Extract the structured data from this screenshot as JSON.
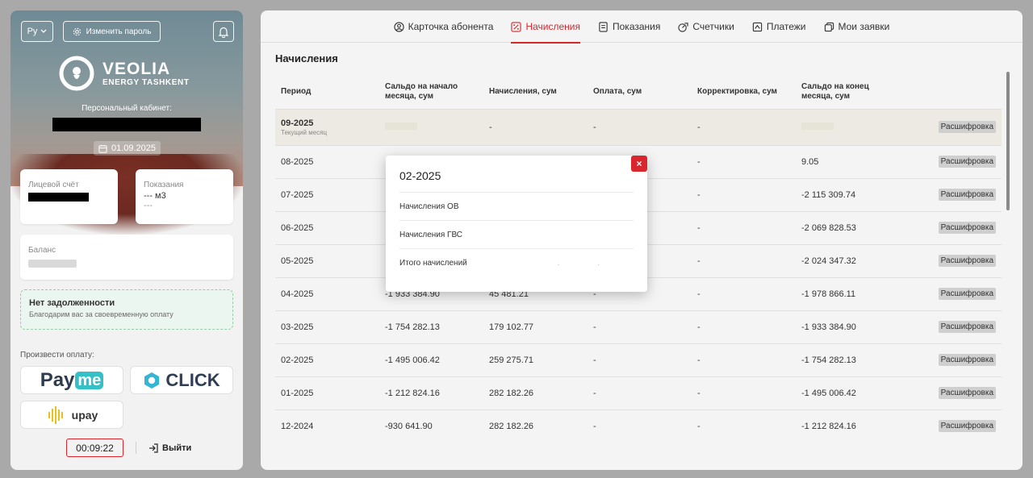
{
  "left": {
    "language": "Ру",
    "change_password": "Изменить пароль",
    "brand": {
      "line1": "VEOLIA",
      "line2": "ENERGY TASHKENT"
    },
    "personal_cabinet_label": "Персональный кабинет:",
    "date": "01.09.2025",
    "account_label": "Лицевой счёт",
    "readings_label": "Показания",
    "readings_value": "--- м3",
    "readings_sub": "---",
    "balance_label": "Баланс",
    "status_title": "Нет задолженности",
    "status_subtitle": "Благодарим вас за своевременную оплату",
    "pay_label": "Произвести оплату:",
    "payments": {
      "payme_a": "Pay",
      "payme_b": "me",
      "click": "CLICK",
      "upay": "upay"
    },
    "timer": "00:09:22",
    "logout": "Выйти"
  },
  "tabs": [
    {
      "label": "Карточка абонента",
      "icon": "user-circle-icon"
    },
    {
      "label": "Начисления",
      "icon": "percent-icon",
      "active": true
    },
    {
      "label": "Показания",
      "icon": "document-icon"
    },
    {
      "label": "Счетчики",
      "icon": "meter-icon"
    },
    {
      "label": "Платежи",
      "icon": "payment-icon"
    },
    {
      "label": "Мои заявки",
      "icon": "requests-icon"
    }
  ],
  "main": {
    "title": "Начисления",
    "columns": [
      "Период",
      "Сальдо на начало месяца, сум",
      "Начисления, сум",
      "Оплата, сум",
      "Корректировка, сум",
      "Сальдо на конец месяца, сум"
    ],
    "action_label": "Расшифровка",
    "rows": [
      {
        "period": "09-2025",
        "sub": "Текущий месяц",
        "start": "",
        "charge": "-",
        "payment": "-",
        "correction": "-",
        "end": ""
      },
      {
        "period": "08-2025",
        "start": "",
        "charge": "",
        "payment": "",
        "correction": "-",
        "end": "9.05"
      },
      {
        "period": "07-2025",
        "start": "",
        "charge": "",
        "payment": "",
        "correction": "-",
        "end": "-2 115 309.74"
      },
      {
        "period": "06-2025",
        "start": "",
        "charge": "",
        "payment": "",
        "correction": "-",
        "end": "-2 069 828.53"
      },
      {
        "period": "05-2025",
        "start": "",
        "charge": "",
        "payment": "",
        "correction": "-",
        "end": "-2 024 347.32"
      },
      {
        "period": "04-2025",
        "start": "-1 933 384.90",
        "charge": "45 481.21",
        "payment": "-",
        "correction": "-",
        "end": "-1 978 866.11"
      },
      {
        "period": "03-2025",
        "start": "-1 754 282.13",
        "charge": "179 102.77",
        "payment": "-",
        "correction": "-",
        "end": "-1 933 384.90"
      },
      {
        "period": "02-2025",
        "start": "-1 495 006.42",
        "charge": "259 275.71",
        "payment": "-",
        "correction": "-",
        "end": "-1 754 282.13"
      },
      {
        "period": "01-2025",
        "start": "-1 212 824.16",
        "charge": "282 182.26",
        "payment": "-",
        "correction": "-",
        "end": "-1 495 006.42"
      },
      {
        "period": "12-2024",
        "start": "-930 641.90",
        "charge": "282 182.26",
        "payment": "-",
        "correction": "-",
        "end": "-1 212 824.16"
      }
    ]
  },
  "modal": {
    "title": "02-2025",
    "close": "×",
    "rows": [
      {
        "label": "Начисления ОВ"
      },
      {
        "label": "Начисления ГВС"
      },
      {
        "label": "Итого начислений",
        "value": ". ."
      }
    ]
  },
  "colors": {
    "accent": "#d9262c",
    "status_bg": "#ecf6f0",
    "status_border": "#9acbab"
  }
}
